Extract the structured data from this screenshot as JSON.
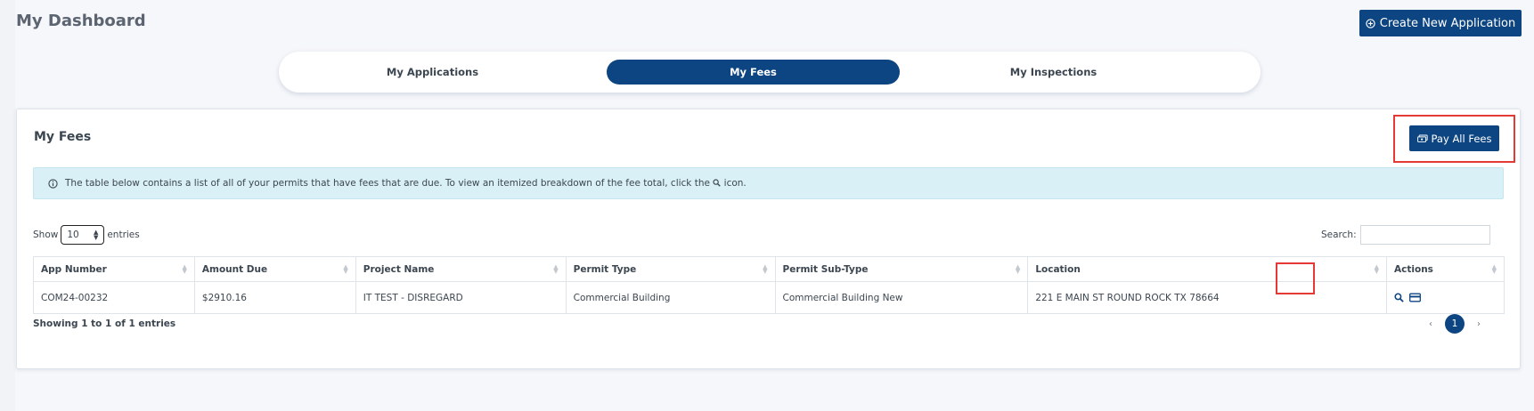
{
  "header": {
    "title": "My Dashboard",
    "create_button_label": "Create New Application"
  },
  "tabs": [
    {
      "label": "My Applications",
      "active": false
    },
    {
      "label": "My Fees",
      "active": true
    },
    {
      "label": "My Inspections",
      "active": false
    }
  ],
  "card": {
    "title": "My Fees",
    "pay_all_label": "Pay All Fees",
    "info_text_before": "The table below contains a list of all of your permits that have fees that are due. To view an itemized breakdown of the fee total, click the",
    "info_text_after": "icon."
  },
  "table_controls": {
    "show_label": "Show",
    "entries_label": "entries",
    "page_length": "10",
    "search_label": "Search:",
    "search_value": ""
  },
  "table": {
    "columns": [
      "App Number",
      "Amount Due",
      "Project Name",
      "Permit Type",
      "Permit Sub-Type",
      "Location",
      "Actions"
    ],
    "rows": [
      {
        "app_number": "COM24-00232",
        "amount_due": "$2910.16",
        "project_name": "IT TEST - DISREGARD",
        "permit_type": "Commercial Building",
        "permit_subtype": "Commercial Building New",
        "location": "221 E MAIN ST ROUND ROCK TX 78664"
      }
    ]
  },
  "footer": {
    "info": "Showing 1 to 1 of 1 entries",
    "prev": "‹",
    "current_page": "1",
    "next": "›"
  },
  "colors": {
    "brand": "#0c4581",
    "alert_bg": "#d9f0f6",
    "highlight": "#e53935",
    "page_bg": "#f6f7fa"
  },
  "icons": {
    "create": "plus-circle-icon",
    "pay_all": "money-icon",
    "info": "info-circle-icon",
    "view": "search-icon",
    "pay": "credit-card-icon"
  }
}
